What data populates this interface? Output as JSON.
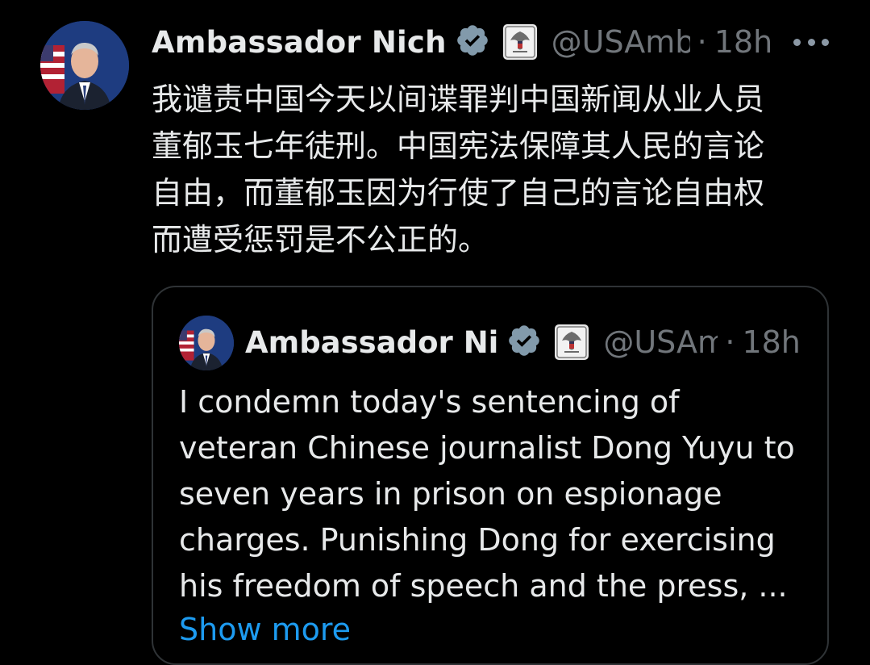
{
  "tweet": {
    "author_name": "Ambassador Nich",
    "handle": "@USAmb",
    "separator": "·",
    "time": "18h",
    "text": "我谴责中国今天以间谍罪判中国新闻从业人员\n董郁玉七年徒刑。中国宪法保障其人民的言论\n自由，而董郁玉因为行使了自己的言论自由权\n而遭受惩罚是不公正的。",
    "verified_icon": "verified-badge-icon",
    "affiliate_icon": "us-seal-icon",
    "menu_icon": "more-options-icon"
  },
  "quote": {
    "author_name": "Ambassador Ni",
    "handle": "@USAm",
    "separator": "·",
    "time": "18h",
    "text": "I condemn today's sentencing of\nveteran Chinese journalist Dong Yuyu to\nseven years in prison on espionage\ncharges.  Punishing Dong for exercising\nhis freedom of speech and the press, ...",
    "show_more_label": "Show more"
  },
  "colors": {
    "background": "#000000",
    "text": "#e7e9ea",
    "secondary": "#71767b",
    "link": "#1d9bf0",
    "border": "#2f3336",
    "verified_badge": "#829aab"
  }
}
